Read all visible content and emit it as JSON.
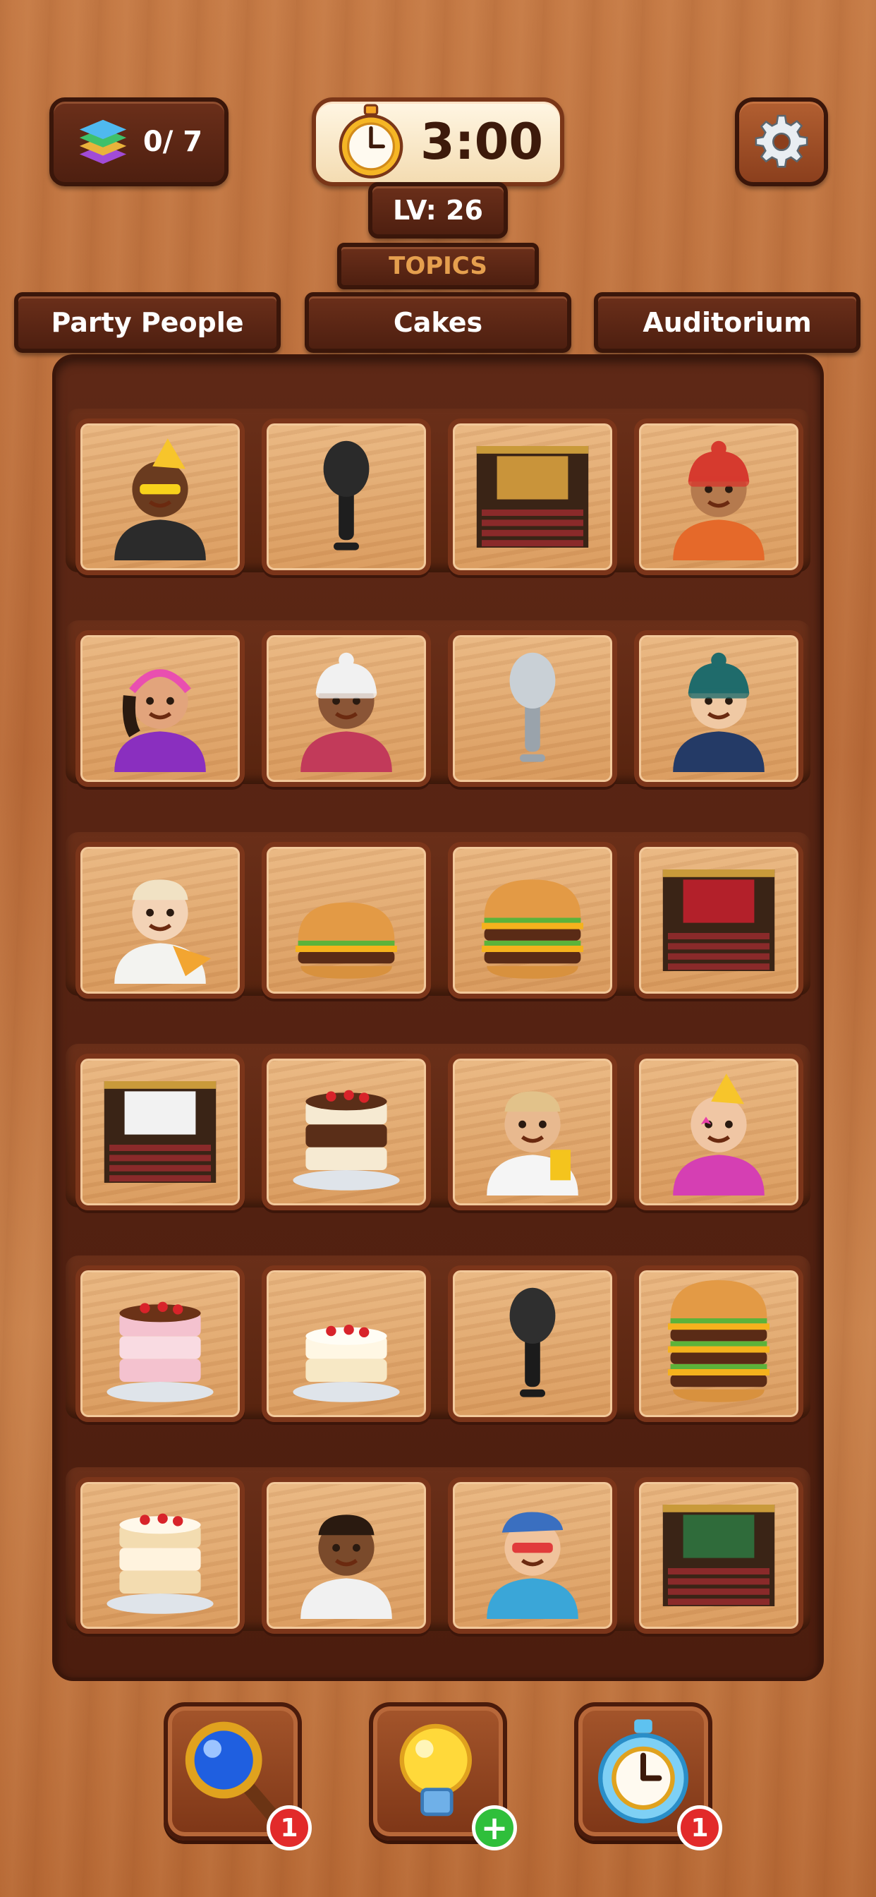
{
  "hud": {
    "moves": "0/ 7",
    "timer": "3:00",
    "level": "LV: 26",
    "topics_label": "TOPICS"
  },
  "topics": [
    "Party People",
    "Cakes",
    "Auditorium"
  ],
  "board": {
    "rows": [
      [
        "party-man-sunglasses",
        "black-microphone",
        "auditorium-stage-piano",
        "man-winter-hat"
      ],
      [
        "party-woman-headband",
        "woman-winter-hat",
        "vintage-microphone",
        "boy-beanie"
      ],
      [
        "man-eating-pizza",
        "chicken-burger",
        "cheeseburger",
        "red-curtain-stage"
      ],
      [
        "lecture-auditorium",
        "chocolate-drip-cake",
        "boy-eating-fries",
        "party-woman-star-glasses"
      ],
      [
        "pink-drip-cake",
        "berry-cake",
        "rgb-microphone",
        "triple-burger"
      ],
      [
        "birthday-candle-cake",
        "boy-eating-pie",
        "party-guy-hawaiian-shirt",
        "school-auditorium"
      ]
    ]
  },
  "powerups": [
    {
      "name": "magnifier-icon",
      "badge": "1",
      "badge_color": "#e22a2a"
    },
    {
      "name": "lightbulb-icon",
      "badge": "+",
      "badge_color": "#2fbf3b"
    },
    {
      "name": "freeze-timer-icon",
      "badge": "1",
      "badge_color": "#e22a2a"
    }
  ]
}
